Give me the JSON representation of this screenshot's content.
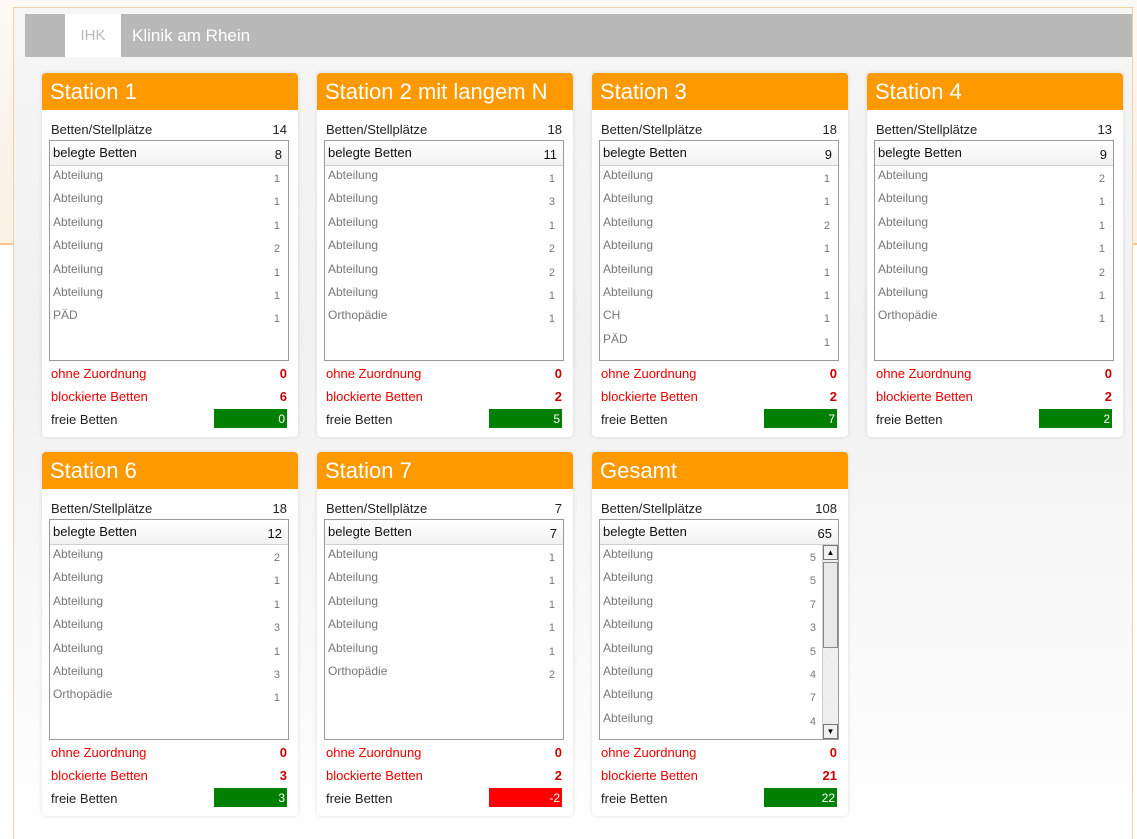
{
  "app": {
    "logo": "IHK",
    "title": "Klinik am Rhein"
  },
  "labels": {
    "capacity": "Betten/Stellplätze",
    "occupied": "belegte Betten",
    "unassigned": "ohne Zuordnung",
    "blocked": "blockierte Betten",
    "free": "freie Betten"
  },
  "colors": {
    "accent": "#ff9900",
    "free_ok": "#008000",
    "free_negative": "#ff0000",
    "alert_text": "#ee0000"
  },
  "cards": [
    {
      "name": "Station 1",
      "capacity": "14",
      "occupied": "8",
      "items": [
        [
          "Abteilung",
          "1"
        ],
        [
          "Abteilung",
          "1"
        ],
        [
          "Abteilung",
          "1"
        ],
        [
          "Abteilung",
          "2"
        ],
        [
          "Abteilung",
          "1"
        ],
        [
          "Abteilung",
          "1"
        ],
        [
          "PÄD",
          "1"
        ]
      ],
      "unassigned": "0",
      "blocked": "6",
      "free": "0",
      "free_status": "ok"
    },
    {
      "name": "Station 2 mit langem N",
      "capacity": "18",
      "occupied": "11",
      "items": [
        [
          "Abteilung",
          "1"
        ],
        [
          "Abteilung",
          "3"
        ],
        [
          "Abteilung",
          "1"
        ],
        [
          "Abteilung",
          "2"
        ],
        [
          "Abteilung",
          "2"
        ],
        [
          "Abteilung",
          "1"
        ],
        [
          "Orthopädie",
          "1"
        ]
      ],
      "unassigned": "0",
      "blocked": "2",
      "free": "5",
      "free_status": "ok"
    },
    {
      "name": "Station 3",
      "capacity": "18",
      "occupied": "9",
      "items": [
        [
          "Abteilung",
          "1"
        ],
        [
          "Abteilung",
          "1"
        ],
        [
          "Abteilung",
          "2"
        ],
        [
          "Abteilung",
          "1"
        ],
        [
          "Abteilung",
          "1"
        ],
        [
          "Abteilung",
          "1"
        ],
        [
          "CH",
          "1"
        ],
        [
          "PÄD",
          "1"
        ]
      ],
      "unassigned": "0",
      "blocked": "2",
      "free": "7",
      "free_status": "ok"
    },
    {
      "name": "Station 4",
      "capacity": "13",
      "occupied": "9",
      "items": [
        [
          "Abteilung",
          "2"
        ],
        [
          "Abteilung",
          "1"
        ],
        [
          "Abteilung",
          "1"
        ],
        [
          "Abteilung",
          "1"
        ],
        [
          "Abteilung",
          "2"
        ],
        [
          "Abteilung",
          "1"
        ],
        [
          "Orthopädie",
          "1"
        ]
      ],
      "unassigned": "0",
      "blocked": "2",
      "free": "2",
      "free_status": "ok"
    },
    {
      "name": "Station 6",
      "capacity": "18",
      "occupied": "12",
      "items": [
        [
          "Abteilung",
          "2"
        ],
        [
          "Abteilung",
          "1"
        ],
        [
          "Abteilung",
          "1"
        ],
        [
          "Abteilung",
          "3"
        ],
        [
          "Abteilung",
          "1"
        ],
        [
          "Abteilung",
          "3"
        ],
        [
          "Orthopädie",
          "1"
        ]
      ],
      "unassigned": "0",
      "blocked": "3",
      "free": "3",
      "free_status": "ok"
    },
    {
      "name": "Station 7",
      "capacity": "7",
      "occupied": "7",
      "items": [
        [
          "Abteilung",
          "1"
        ],
        [
          "Abteilung",
          "1"
        ],
        [
          "Abteilung",
          "1"
        ],
        [
          "Abteilung",
          "1"
        ],
        [
          "Abteilung",
          "1"
        ],
        [
          "Orthopädie",
          "2"
        ]
      ],
      "unassigned": "0",
      "blocked": "2",
      "free": "-2",
      "free_status": "negative"
    },
    {
      "name": "Gesamt",
      "capacity": "108",
      "occupied": "65",
      "items": [
        [
          "Abteilung",
          "5"
        ],
        [
          "Abteilung",
          "5"
        ],
        [
          "Abteilung",
          "7"
        ],
        [
          "Abteilung",
          "3"
        ],
        [
          "Abteilung",
          "5"
        ],
        [
          "Abteilung",
          "4"
        ],
        [
          "Abteilung",
          "7"
        ],
        [
          "Abteilung",
          "4"
        ]
      ],
      "unassigned": "0",
      "blocked": "21",
      "free": "22",
      "free_status": "ok",
      "scrollable": true
    }
  ]
}
